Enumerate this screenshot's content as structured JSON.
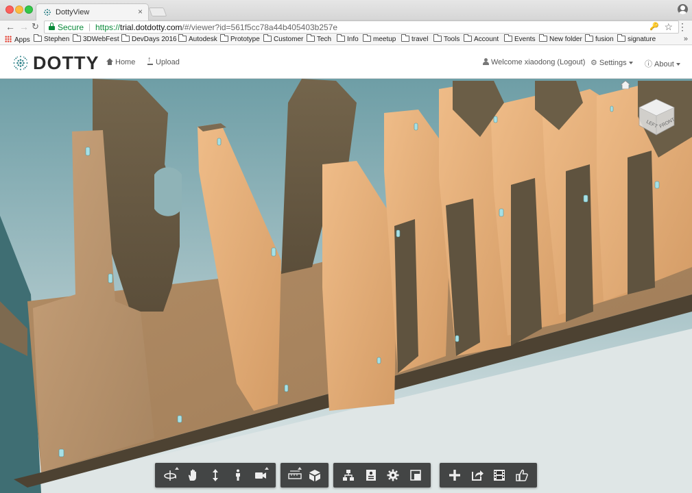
{
  "browser": {
    "tab_title": "DottyView",
    "tab_close": "×",
    "secure_label": "Secure",
    "url_scheme": "https://",
    "url_host": "trial.dotdotty.com",
    "url_path": "/#/viewer?id=561f5cc78a44b405403b257e",
    "bookmarks": {
      "apps": "Apps",
      "items": [
        "Stephen",
        "3DWebFest",
        "DevDays 2016",
        "Autodesk",
        "Prototype",
        "Customer",
        "Tech",
        "Info",
        "meetup",
        "travel",
        "Tools",
        "Account",
        "Events",
        "New folder",
        "fusion",
        "signature"
      ],
      "more": "»"
    }
  },
  "app": {
    "logo_text": "DOTTY",
    "nav": {
      "home": "Home",
      "upload": "Upload",
      "welcome": "Welcome xiaodong (Logout)",
      "settings": "Settings",
      "about": "About"
    }
  },
  "viewer": {
    "viewcube_faces": [
      "LEFT",
      "FRONT"
    ],
    "toolbar_groups": [
      [
        "orbit-icon",
        "pan-icon",
        "zoom-icon",
        "first-person-icon",
        "camera-icon"
      ],
      [
        "measure-icon",
        "explode-icon"
      ],
      [
        "model-browser-icon",
        "properties-icon",
        "settings-icon",
        "fullscreen-icon"
      ],
      [
        "add-icon",
        "share-icon",
        "animation-icon",
        "like-icon"
      ]
    ]
  },
  "colors": {
    "secure_green": "#0a8a3a",
    "sky_top": "#6e9ea6",
    "sky_bottom": "#e4eaeb",
    "wood_light": "#e0ad78",
    "wood_dark": "#6e6048",
    "toolbar_bg": "#2f2f2f"
  }
}
